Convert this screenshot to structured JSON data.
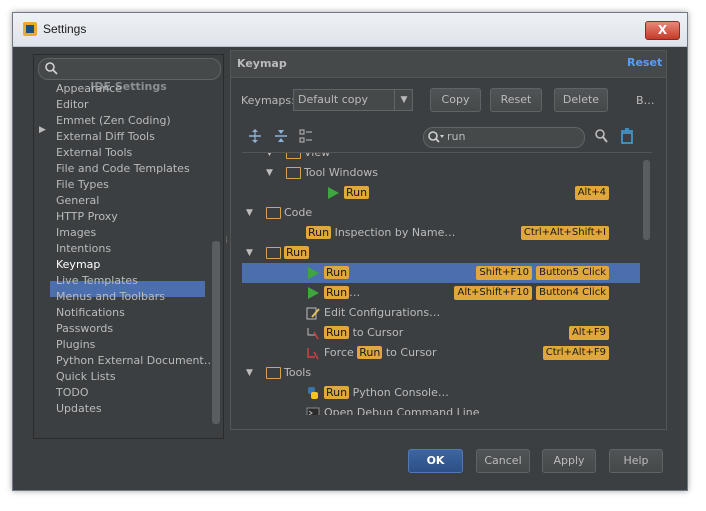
{
  "window": {
    "title": "Settings",
    "close_label": "X"
  },
  "sidebar": {
    "header": "IDE Settings",
    "items": [
      {
        "label": "Appearance"
      },
      {
        "label": "Editor"
      },
      {
        "label": "Emmet (Zen Coding)"
      },
      {
        "label": "External Diff Tools"
      },
      {
        "label": "External Tools"
      },
      {
        "label": "File and Code Templates"
      },
      {
        "label": "File Types"
      },
      {
        "label": "General"
      },
      {
        "label": "HTTP Proxy"
      },
      {
        "label": "Images"
      },
      {
        "label": "Intentions"
      },
      {
        "label": "Keymap"
      },
      {
        "label": "Live Templates"
      },
      {
        "label": "Menus and Toolbars"
      },
      {
        "label": "Notifications"
      },
      {
        "label": "Passwords"
      },
      {
        "label": "Plugins"
      },
      {
        "label": "Python External Document…"
      },
      {
        "label": "Quick Lists"
      },
      {
        "label": "TODO"
      },
      {
        "label": "Updates"
      }
    ],
    "selected": "Keymap"
  },
  "keymap": {
    "title": "Keymap",
    "reset_link": "Reset",
    "keymaps_label": "Keymaps:",
    "selected_keymap": "Default copy",
    "buttons": {
      "copy": "Copy",
      "reset": "Reset",
      "delete": "Delete",
      "more": "B…"
    },
    "filter_value": "run"
  },
  "tree": {
    "rows": [
      {
        "before": "",
        "hl": "",
        "after": "View",
        "shortcuts": []
      },
      {
        "before": "Tool Windows",
        "hl": "",
        "after": "",
        "shortcuts": []
      },
      {
        "before": "",
        "hl": "Run",
        "after": "",
        "shortcuts": [
          "Alt+4"
        ]
      },
      {
        "before": "Code",
        "hl": "",
        "after": "",
        "shortcuts": []
      },
      {
        "before": "",
        "hl": "Run",
        "after": " Inspection by Name…",
        "shortcuts": [
          "Ctrl+Alt+Shift+I"
        ]
      },
      {
        "before": "",
        "hl": "Run",
        "after": "",
        "shortcuts": []
      },
      {
        "before": "",
        "hl": "Run",
        "after": "",
        "shortcuts": [
          "Shift+F10",
          "Button5 Click"
        ]
      },
      {
        "before": "",
        "hl": "Run",
        "after": "…",
        "shortcuts": [
          "Alt+Shift+F10",
          "Button4 Click"
        ]
      },
      {
        "before": "Edit Configurations…",
        "hl": "",
        "after": "",
        "shortcuts": []
      },
      {
        "before": "",
        "hl": "Run",
        "after": " to Cursor",
        "shortcuts": [
          "Alt+F9"
        ]
      },
      {
        "before": "Force ",
        "hl": "Run",
        "after": " to Cursor",
        "shortcuts": [
          "Ctrl+Alt+F9"
        ]
      },
      {
        "before": "Tools",
        "hl": "",
        "after": "",
        "shortcuts": []
      },
      {
        "before": "",
        "hl": "Run",
        "after": " Python Console…",
        "shortcuts": []
      },
      {
        "before": "Open Debug Command Line",
        "hl": "",
        "after": "",
        "shortcuts": []
      }
    ]
  },
  "footer": {
    "ok": "OK",
    "cancel": "Cancel",
    "apply": "Apply",
    "help": "Help"
  },
  "colors": {
    "selection": "#4b6eaf",
    "highlight": "#e0a73a",
    "background": "#3c3f41",
    "link": "#589df6"
  }
}
